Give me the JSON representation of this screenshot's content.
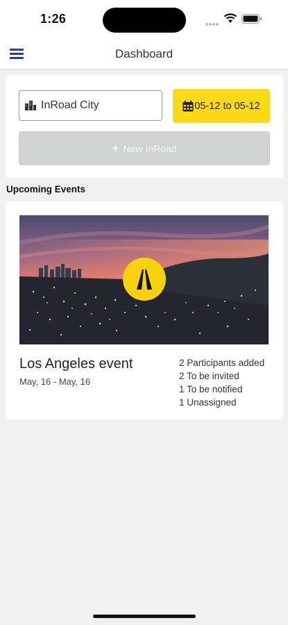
{
  "status_bar": {
    "time": "1:26",
    "icons": [
      "signal-dots-icon",
      "wifi-icon",
      "battery-icon"
    ]
  },
  "nav": {
    "title": "Dashboard",
    "menu_icon": "hamburger-menu-icon"
  },
  "filters": {
    "city_value": "InRoad City",
    "city_icon": "city-buildings-icon",
    "date_range": "05-12 to 05-12",
    "date_icon": "calendar-icon",
    "new_button_label": "New InRoad",
    "new_button_icon": "plus-icon"
  },
  "upcoming": {
    "section_title": "Upcoming Events",
    "events": [
      {
        "name": "Los Angeles event",
        "dates": "May, 16 - May, 16",
        "image": "city-skyline-at-dusk",
        "logo_icon": "road-logo-icon",
        "stats": [
          "2 Participants added",
          "2 To be invited",
          "1 To be notified",
          "1 Unassigned"
        ]
      }
    ]
  },
  "colors": {
    "accent_yellow": "#fbd914",
    "menu_blue": "#2a3a9c",
    "disabled_gray": "#d1d3d3",
    "background": "#f0f0f0"
  }
}
